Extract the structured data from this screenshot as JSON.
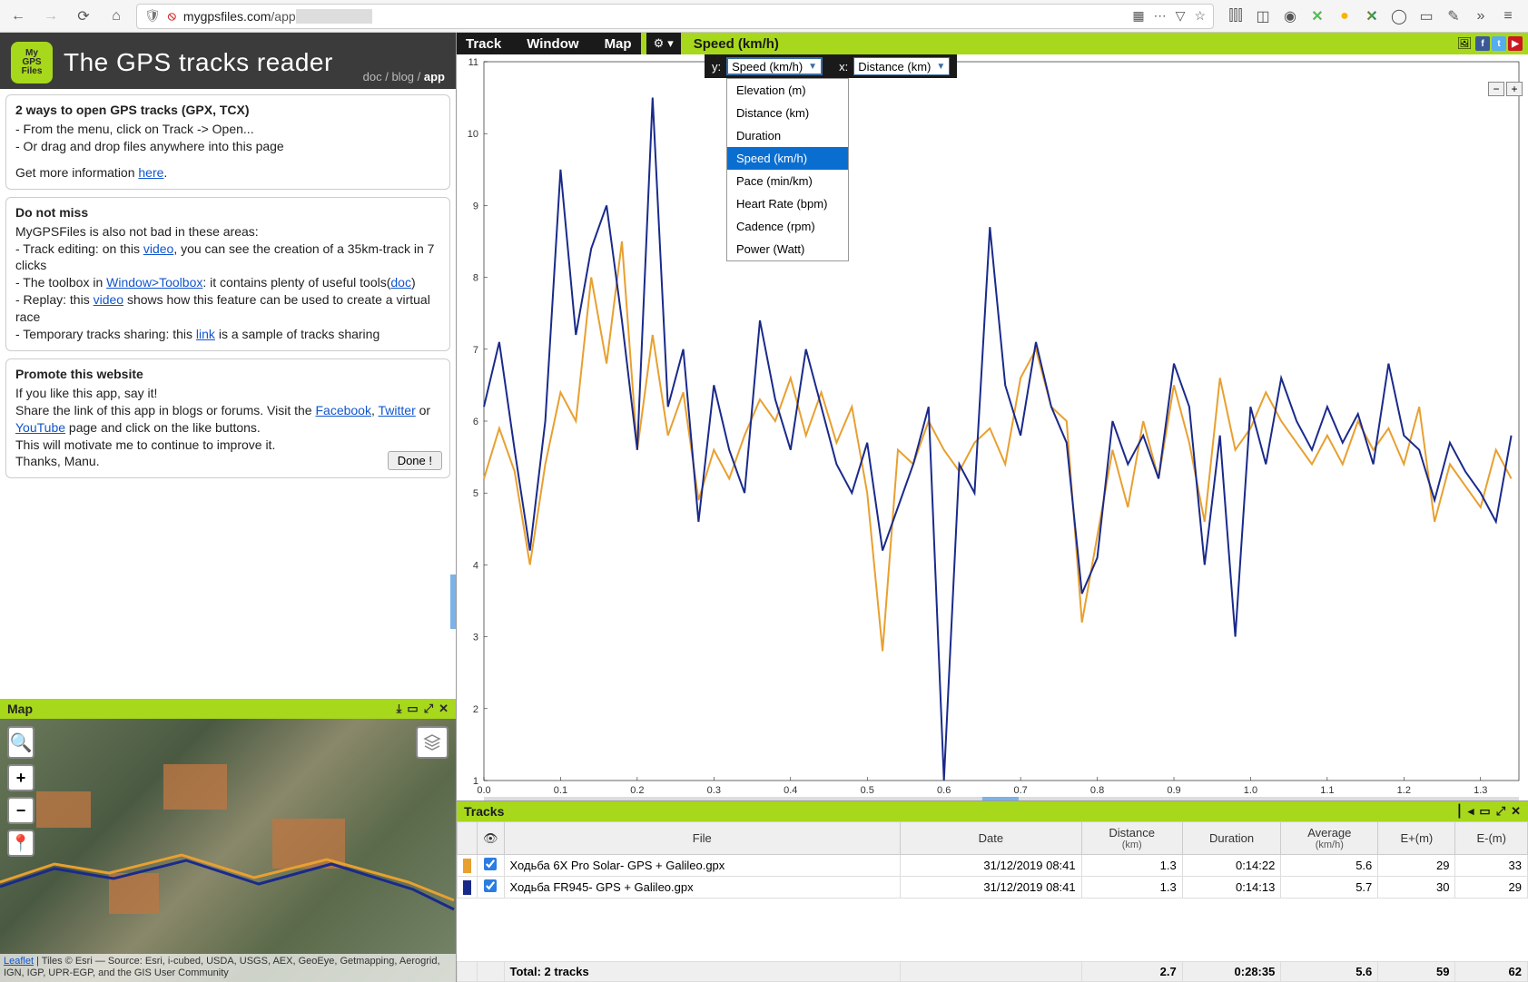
{
  "browser": {
    "url_domain": "mygpsfiles.com",
    "url_path": "/app"
  },
  "header": {
    "logo_lines": [
      "My",
      "GPS",
      "Files"
    ],
    "title": "The GPS tracks reader",
    "links": {
      "doc": "doc",
      "blog": "blog",
      "app": "app"
    }
  },
  "panel_open": {
    "title": "2 ways to open GPS tracks (GPX, TCX)",
    "line1": "- From the menu, click on Track -> Open...",
    "line2": "- Or drag and drop files anywhere into this page",
    "line3_a": "Get more information ",
    "line3_link": "here",
    "line3_b": "."
  },
  "panel_miss": {
    "title": "Do not miss",
    "intro": "MyGPSFiles is also not bad in these areas:",
    "l1a": "- Track editing: on this ",
    "l1link": "video",
    "l1b": ", you can see the creation of a 35km-track in 7 clicks",
    "l2a": "- The toolbox in ",
    "l2link": "Window>Toolbox",
    "l2b": ": it contains plenty of useful tools(",
    "l2link2": "doc",
    "l2c": ")",
    "l3a": "- Replay: this ",
    "l3link": "video",
    "l3b": " shows how this feature can be used to create a virtual race",
    "l4a": "- Temporary tracks sharing: this ",
    "l4link": "link",
    "l4b": " is a sample of tracks sharing"
  },
  "panel_promote": {
    "title": "Promote this website",
    "l1": "If you like this app, say it!",
    "l2a": "Share the link of this app in blogs or forums. Visit the ",
    "fb": "Facebook",
    "comma": ", ",
    "tw": "Twitter",
    "or": " or ",
    "yt": "YouTube",
    "l2b": " page and click on the like buttons.",
    "l3": "This will motivate me to continue to improve it.",
    "l4": "Thanks, Manu.",
    "done": "Done !"
  },
  "map": {
    "title": "Map",
    "attrib_leaflet": "Leaflet",
    "attrib_rest": " | Tiles © Esri — Source: Esri, i-cubed, USDA, USGS, AEX, GeoEye, Getmapping, Aerogrid, IGN, IGP, UPR-EGP, and the GIS User Community"
  },
  "chart_menu": {
    "track": "Track",
    "window": "Window",
    "map": "Map"
  },
  "chart_title": "Speed (km/h)",
  "axis": {
    "y_label": "y:",
    "y_value": "Speed (km/h)",
    "x_label": "x:",
    "x_value": "Distance (km)"
  },
  "dropdown": {
    "items": [
      "Elevation (m)",
      "Distance (km)",
      "Duration",
      "Speed (km/h)",
      "Pace (min/km)",
      "Heart Rate (bpm)",
      "Cadence (rpm)",
      "Power (Watt)"
    ],
    "selected_index": 3
  },
  "chart_data": {
    "type": "line",
    "title": "Speed (km/h)",
    "xlabel": "Distance (km)",
    "ylabel": "Speed (km/h)",
    "xlim": [
      0,
      1.35
    ],
    "ylim": [
      1,
      11
    ],
    "x_ticks": [
      0.0,
      0.1,
      0.2,
      0.3,
      0.4,
      0.5,
      0.6,
      0.7,
      0.8,
      0.9,
      1.0,
      1.1,
      1.2,
      1.3
    ],
    "y_ticks": [
      1,
      2,
      3,
      4,
      5,
      6,
      7,
      8,
      9,
      10,
      11
    ],
    "x": [
      0.0,
      0.02,
      0.04,
      0.06,
      0.08,
      0.1,
      0.12,
      0.14,
      0.16,
      0.18,
      0.2,
      0.22,
      0.24,
      0.26,
      0.28,
      0.3,
      0.32,
      0.34,
      0.36,
      0.38,
      0.4,
      0.42,
      0.44,
      0.46,
      0.48,
      0.5,
      0.52,
      0.54,
      0.56,
      0.58,
      0.6,
      0.62,
      0.64,
      0.66,
      0.68,
      0.7,
      0.72,
      0.74,
      0.76,
      0.78,
      0.8,
      0.82,
      0.84,
      0.86,
      0.88,
      0.9,
      0.92,
      0.94,
      0.96,
      0.98,
      1.0,
      1.02,
      1.04,
      1.06,
      1.08,
      1.1,
      1.12,
      1.14,
      1.16,
      1.18,
      1.2,
      1.22,
      1.24,
      1.26,
      1.28,
      1.3,
      1.32,
      1.34
    ],
    "series": [
      {
        "name": "Ходьба 6X Pro Solar- GPS + Galileo.gpx",
        "color": "#e8a030",
        "values": [
          5.2,
          5.9,
          5.3,
          4.0,
          5.4,
          6.4,
          6.0,
          8.0,
          6.8,
          8.5,
          5.6,
          7.2,
          5.8,
          6.4,
          4.9,
          5.6,
          5.2,
          5.8,
          6.3,
          6.0,
          6.6,
          5.8,
          6.4,
          5.7,
          6.2,
          5.0,
          2.8,
          5.6,
          5.4,
          6.0,
          5.6,
          5.3,
          5.7,
          5.9,
          5.4,
          6.6,
          7.0,
          6.2,
          6.0,
          3.2,
          4.4,
          5.6,
          4.8,
          6.0,
          5.2,
          6.5,
          5.7,
          4.6,
          6.6,
          5.6,
          5.9,
          6.4,
          6.0,
          5.7,
          5.4,
          5.8,
          5.4,
          6.0,
          5.6,
          5.9,
          5.4,
          6.2,
          4.6,
          5.4,
          5.1,
          4.8,
          5.6,
          5.2
        ]
      },
      {
        "name": "Ходьба FR945- GPS + Galileo.gpx",
        "color": "#1a2a8a",
        "values": [
          6.2,
          7.1,
          5.6,
          4.2,
          6.0,
          9.5,
          7.2,
          8.4,
          9.0,
          7.4,
          5.6,
          10.5,
          6.2,
          7.0,
          4.6,
          6.5,
          5.6,
          5.0,
          7.4,
          6.3,
          5.6,
          7.0,
          6.2,
          5.4,
          5.0,
          5.7,
          4.2,
          4.8,
          5.4,
          6.2,
          1.0,
          5.4,
          5.0,
          8.7,
          6.5,
          5.8,
          7.1,
          6.2,
          5.7,
          3.6,
          4.1,
          6.0,
          5.4,
          5.8,
          5.2,
          6.8,
          6.2,
          4.0,
          5.8,
          3.0,
          6.2,
          5.4,
          6.6,
          6.0,
          5.6,
          6.2,
          5.7,
          6.1,
          5.4,
          6.8,
          5.8,
          5.6,
          4.9,
          5.7,
          5.3,
          5.0,
          4.6,
          5.8
        ]
      }
    ]
  },
  "tracks": {
    "title": "Tracks",
    "cols": {
      "eye": "👁",
      "file": "File",
      "date": "Date",
      "distance": "Distance",
      "distance_unit": "(km)",
      "duration": "Duration",
      "average": "Average",
      "average_unit": "(km/h)",
      "eplus": "E+(m)",
      "eminus": "E-(m)"
    },
    "rows": [
      {
        "color": "orange",
        "file": "Ходьба 6X Pro Solar- GPS + Galileo.gpx",
        "date": "31/12/2019 08:41",
        "distance": "1.3",
        "duration": "0:14:22",
        "average": "5.6",
        "eplus": "29",
        "eminus": "33"
      },
      {
        "color": "blue",
        "file": "Ходьба FR945- GPS + Galileo.gpx",
        "date": "31/12/2019 08:41",
        "distance": "1.3",
        "duration": "0:14:13",
        "average": "5.7",
        "eplus": "30",
        "eminus": "29"
      }
    ],
    "total": {
      "label": "Total: 2 tracks",
      "distance": "2.7",
      "duration": "0:28:35",
      "average": "5.6",
      "eplus": "59",
      "eminus": "62"
    }
  }
}
